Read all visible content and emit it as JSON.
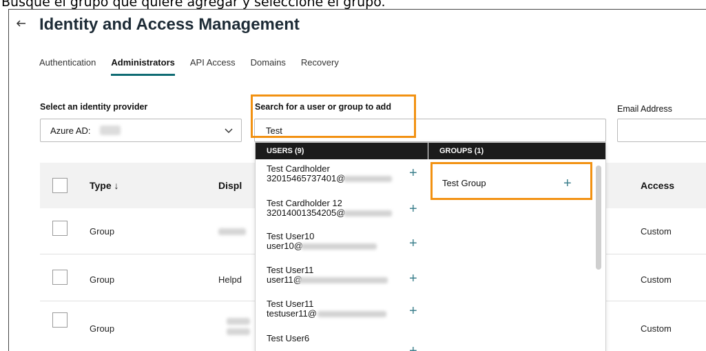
{
  "caption": "Busque el grupo que quiere agregar y seleccione el grupo.",
  "header": {
    "back_icon": "back-arrow-icon",
    "title": "Identity and Access Management"
  },
  "tabs": [
    {
      "label": "Authentication",
      "active": false
    },
    {
      "label": "Administrators",
      "active": true
    },
    {
      "label": "API Access",
      "active": false
    },
    {
      "label": "Domains",
      "active": false
    },
    {
      "label": "Recovery",
      "active": false
    }
  ],
  "identity_provider": {
    "label": "Select an identity provider",
    "value": "Azure AD:",
    "chevron_icon": "chevron-down-icon"
  },
  "search": {
    "label": "Search for a user or group to add",
    "value": "Test"
  },
  "email": {
    "label": "Email Address"
  },
  "dropdown": {
    "users_header": "USERS (9)",
    "groups_header": "GROUPS (1)",
    "users": [
      {
        "name": "Test Cardholder",
        "email": "32015465737401@"
      },
      {
        "name": "Test Cardholder 12",
        "email": "32014001354205@"
      },
      {
        "name": "Test User10",
        "email": "user10@"
      },
      {
        "name": "Test User11",
        "email": "user11@"
      },
      {
        "name": "Test User11",
        "email": "testuser11@"
      },
      {
        "name": "Test User6",
        "email": ""
      }
    ],
    "groups": [
      {
        "name": "Test Group"
      }
    ],
    "add_symbol": "+"
  },
  "table": {
    "headers": {
      "type": "Type",
      "type_sort_icon": "↓",
      "display": "Displ",
      "access": "Access"
    },
    "rows": [
      {
        "type": "Group",
        "display": "",
        "access": "Custom"
      },
      {
        "type": "Group",
        "display": "Helpd",
        "access": "Custom"
      },
      {
        "type": "Group",
        "display": "",
        "access": "Custom"
      }
    ]
  },
  "colors": {
    "accent": "#0f6b73",
    "highlight": "#f29111",
    "plus": "#3b7f8c",
    "dropdown_header": "#1b1b1b"
  }
}
